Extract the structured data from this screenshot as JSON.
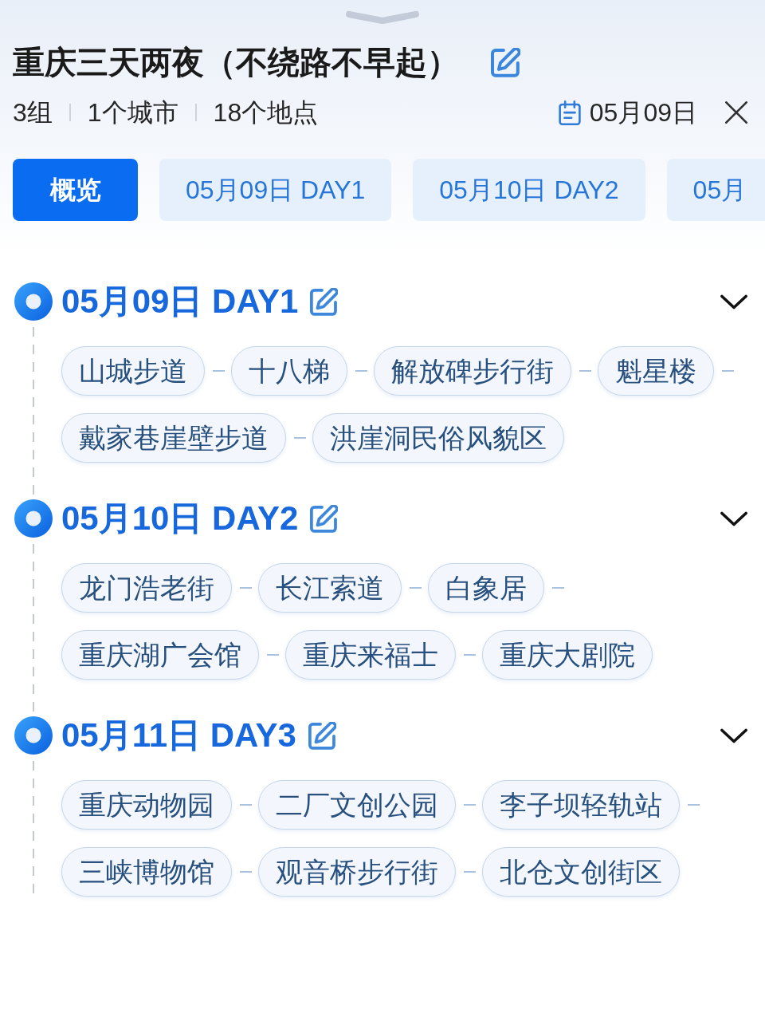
{
  "header": {
    "title": "重庆三天两夜（不绕路不早起）",
    "stats": [
      "3组",
      "1个城市",
      "18个地点"
    ],
    "date": "05月09日"
  },
  "tabs": [
    {
      "label": "概览",
      "selected": true
    },
    {
      "label": "05月09日 DAY1",
      "selected": false
    },
    {
      "label": "05月10日 DAY2",
      "selected": false
    },
    {
      "label": "05月",
      "selected": false
    }
  ],
  "days": [
    {
      "title": "05月09日 DAY1",
      "places": [
        "山城步道",
        "十八梯",
        "解放碑步行街",
        "魁星楼",
        "戴家巷崖壁步道",
        "洪崖洞民俗风貌区"
      ]
    },
    {
      "title": "05月10日 DAY2",
      "places": [
        "龙门浩老街",
        "长江索道",
        "白象居",
        "重庆湖广会馆",
        "重庆来福士",
        "重庆大剧院"
      ]
    },
    {
      "title": "05月11日 DAY3",
      "places": [
        "重庆动物园",
        "二厂文创公园",
        "李子坝轻轨站",
        "三峡博物馆",
        "观音桥步行街",
        "北仓文创街区"
      ]
    }
  ]
}
